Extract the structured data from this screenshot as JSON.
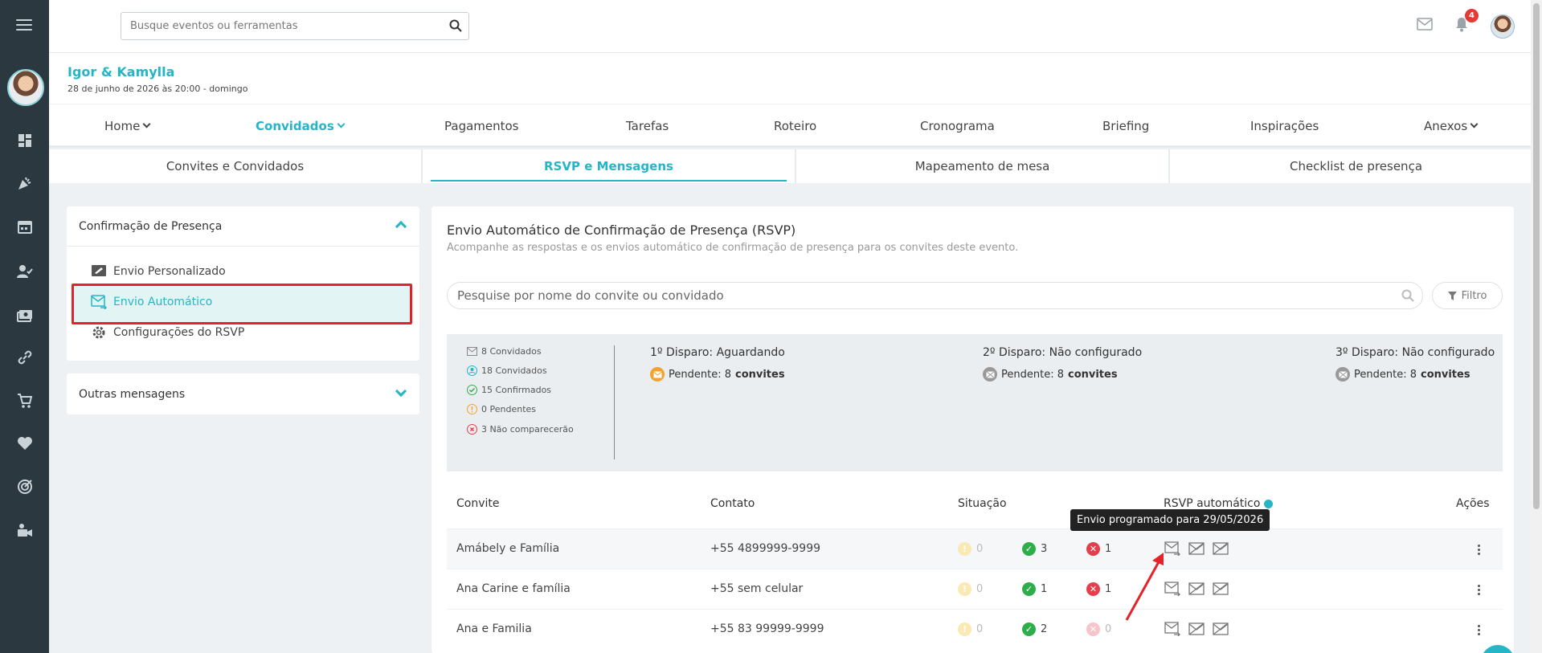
{
  "topbar": {
    "search_placeholder": "Busque eventos ou ferramentas",
    "notification_count": "4"
  },
  "event": {
    "title": "Igor & Kamylla",
    "date": "28 de junho de 2026 às 20:00 - domingo"
  },
  "mainnav": [
    {
      "label": "Home",
      "has_dropdown": true
    },
    {
      "label": "Convidados",
      "has_dropdown": true,
      "active": true
    },
    {
      "label": "Pagamentos"
    },
    {
      "label": "Tarefas"
    },
    {
      "label": "Roteiro"
    },
    {
      "label": "Cronograma"
    },
    {
      "label": "Briefing"
    },
    {
      "label": "Inspirações"
    },
    {
      "label": "Anexos",
      "has_dropdown": true
    }
  ],
  "subtabs": [
    {
      "label": "Convites e Convidados"
    },
    {
      "label": "RSVP e Mensagens",
      "active": true
    },
    {
      "label": "Mapeamento de mesa"
    },
    {
      "label": "Checklist de presença"
    }
  ],
  "left_panel": {
    "section_title": "Confirmação de Presença",
    "items": [
      {
        "label": "Envio Personalizado"
      },
      {
        "label": "Envio Automático",
        "active": true
      },
      {
        "label": "Configurações do RSVP"
      }
    ],
    "other_section": "Outras mensagens"
  },
  "main": {
    "title": "Envio Automático de Confirmação de Presença (RSVP)",
    "subtitle": "Acompanhe as respostas e os envios automático de confirmação de presença para os convites deste evento.",
    "search_placeholder": "Pesquise por nome do convite ou convidado",
    "filter_label": "Filtro",
    "stats": [
      {
        "text": "8 Convidados",
        "icon": "mail-icon"
      },
      {
        "text": "18 Convidados",
        "icon": "person-icon"
      },
      {
        "text": "15 Confirmados",
        "icon": "check-icon"
      },
      {
        "text": "0 Pendentes",
        "icon": "alert-icon"
      },
      {
        "text": "3 Não comparecerão",
        "icon": "x-icon"
      }
    ],
    "disparos": [
      {
        "title": "1º Disparo: Aguardando",
        "pending_prefix": "Pendente: 8",
        "pending_bold": "convites"
      },
      {
        "title": "2º Disparo: Não configurado",
        "pending_prefix": "Pendente: 8",
        "pending_bold": "convites"
      },
      {
        "title": "3º Disparo: Não configurado",
        "pending_prefix": "Pendente: 8",
        "pending_bold": "convites"
      }
    ],
    "table": {
      "headers": {
        "convite": "Convite",
        "contato": "Contato",
        "situacao": "Situação",
        "rsvp": "RSVP automático",
        "acoes": "Ações"
      },
      "rows": [
        {
          "convite": "Amábely e Família",
          "contato": "+55 4899999-9999",
          "pendentes": "0",
          "confirmados": "3",
          "ausentes": "1"
        },
        {
          "convite": "Ana Carine e família",
          "contato": "+55 sem celular",
          "pendentes": "0",
          "confirmados": "1",
          "ausentes": "1"
        },
        {
          "convite": "Ana e Familia",
          "contato": "+55 83 99999-9999",
          "pendentes": "0",
          "confirmados": "2",
          "ausentes": "0"
        }
      ]
    },
    "tooltip": "Envio programado para 29/05/2026"
  },
  "colors": {
    "accent": "#25b5c7",
    "sidebar": "#2b3840",
    "highlight_box": "#e3222a",
    "confirmed": "#2eae4b",
    "declined": "#e53f4d",
    "pending": "#f2c12e"
  }
}
